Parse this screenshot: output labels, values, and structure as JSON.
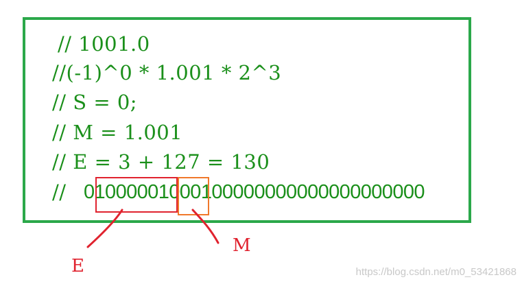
{
  "code": {
    "line1": "// 1001.0",
    "line2": "//(-1)^0 * 1.001 * 2^3",
    "line3": "// S = 0;",
    "line4": "// M = 1.001",
    "line5": "// E = 3 + 127 = 130",
    "line6_prefix": "//",
    "bits": "01000001000100000000000000000000"
  },
  "annotations": {
    "exponent_label": "E",
    "mantissa_label": "M"
  },
  "watermark": "https://blog.csdn.net/m0_53421868",
  "colors": {
    "frame": "#2ba84a",
    "code_text": "#1a8f1a",
    "exponent_box": "#e0222e",
    "mantissa_box": "#f0782a",
    "annotation_text": "#e0222e"
  }
}
